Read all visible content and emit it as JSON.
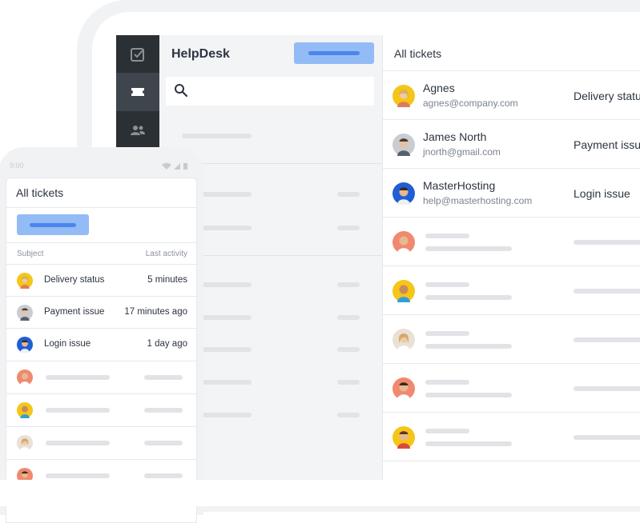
{
  "app": {
    "brand": "HelpDesk",
    "search_placeholder": ""
  },
  "rail": {
    "items": [
      {
        "icon": "checkbox-icon",
        "active": false
      },
      {
        "icon": "ticket-icon",
        "active": true
      },
      {
        "icon": "users-icon",
        "active": false
      }
    ]
  },
  "detail": {
    "title": "All tickets",
    "tickets": [
      {
        "name": "Agnes",
        "email": "agnes@company.com",
        "subject": "Delivery status",
        "avatar_color": "#f5c518"
      },
      {
        "name": "James North",
        "email": "jnorth@gmail.com",
        "subject": "Payment issue",
        "avatar_color": "#c9ccd1"
      },
      {
        "name": "MasterHosting",
        "email": "help@masterhosting.com",
        "subject": "Login issue",
        "avatar_color": "#1f5fd6"
      }
    ],
    "placeholder_avatar_colors": [
      "#f0896f",
      "#f5c518",
      "#e9e1d6",
      "#f0896f",
      "#f5c518"
    ]
  },
  "phone": {
    "time": "9:00",
    "title": "All tickets",
    "columns": {
      "subject": "Subject",
      "last_activity": "Last activity"
    },
    "tickets": [
      {
        "subject": "Delivery status",
        "last_activity": "5 minutes",
        "avatar_color": "#f5c518"
      },
      {
        "subject": "Payment issue",
        "last_activity": "17 minutes ago",
        "avatar_color": "#c9ccd1"
      },
      {
        "subject": "Login issue",
        "last_activity": "1 day ago",
        "avatar_color": "#1f5fd6"
      }
    ],
    "placeholder_avatar_colors": [
      "#f0896f",
      "#f5c518",
      "#e9e1d6",
      "#f0896f"
    ]
  },
  "colors": {
    "accent": "#93bbf6",
    "accent_dark": "#4c86ec",
    "rail": "#2b3035"
  }
}
